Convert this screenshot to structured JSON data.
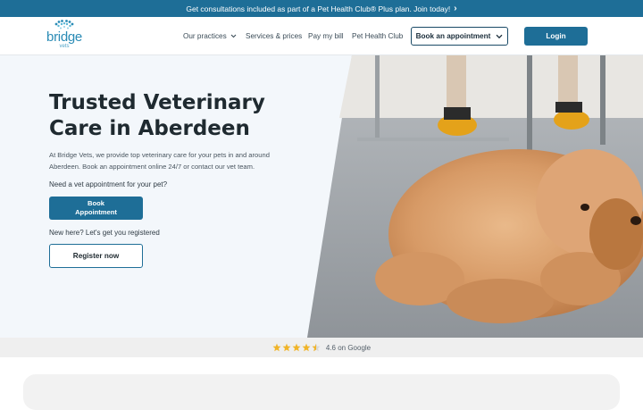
{
  "promo": {
    "text": "Get consultations included as part of a Pet Health Club® Plus plan. Join today!",
    "chevron": "›"
  },
  "brand": {
    "name": "bridge",
    "sub": "vets",
    "logo_icon": "paw-print-icon",
    "accent": "#1e6e97"
  },
  "nav": {
    "items": [
      {
        "label": "Our practices",
        "has_dropdown": true
      },
      {
        "label": "Services & prices"
      },
      {
        "label": "Pay my bill"
      },
      {
        "label": "Pet Health Club"
      }
    ],
    "book_label": "Book an appointment",
    "login_label": "Login"
  },
  "hero": {
    "title": "Trusted Veterinary Care in Aberdeen",
    "intro": "At Bridge Vets, we provide top veterinary care for your pets in and around Aberdeen. Book an appointment online 24/7 or contact our vet team.",
    "question_appointment": "Need a vet appointment for your pet?",
    "book_button": "Book Appointment",
    "question_register": "New here? Let's get you registered",
    "register_button": "Register now"
  },
  "rating": {
    "stars": 4.5,
    "text": "4.6 on Google",
    "star_color": "#f0b429"
  }
}
